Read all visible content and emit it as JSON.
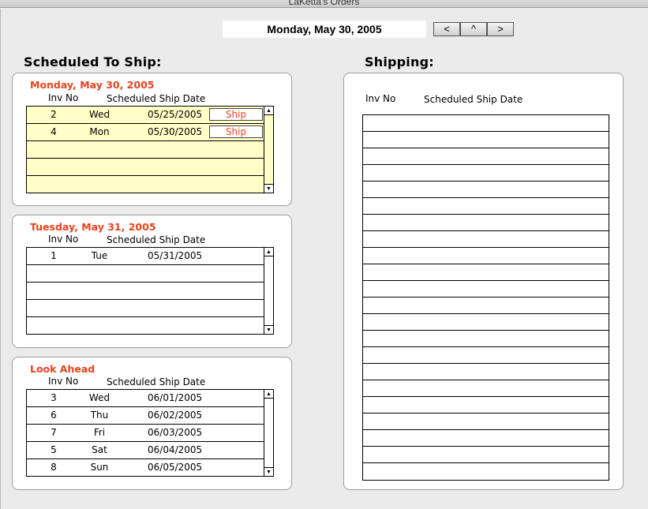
{
  "window": {
    "title": "LaKetta's Orders"
  },
  "header": {
    "date": "Monday, May 30, 2005",
    "nav_prev": "<",
    "nav_up": "^",
    "nav_next": ">"
  },
  "scheduled": {
    "heading": "Scheduled To Ship:",
    "columns": {
      "inv": "Inv No",
      "date": "Scheduled Ship Date"
    },
    "sections": [
      {
        "title": "Monday, May 30, 2005",
        "highlight": "#ffffc8",
        "rows": [
          {
            "inv": "2",
            "day": "Wed",
            "date": "05/25/2005",
            "action": "Ship"
          },
          {
            "inv": "4",
            "day": "Mon",
            "date": "05/30/2005",
            "action": "Ship"
          }
        ]
      },
      {
        "title": "Tuesday, May 31, 2005",
        "rows": [
          {
            "inv": "1",
            "day": "Tue",
            "date": "05/31/2005"
          }
        ]
      },
      {
        "title": "Look Ahead",
        "rows": [
          {
            "inv": "3",
            "day": "Wed",
            "date": "06/01/2005"
          },
          {
            "inv": "6",
            "day": "Thu",
            "date": "06/02/2005"
          },
          {
            "inv": "7",
            "day": "Fri",
            "date": "06/03/2005"
          },
          {
            "inv": "5",
            "day": "Sat",
            "date": "06/04/2005"
          },
          {
            "inv": "8",
            "day": "Sun",
            "date": "06/05/2005"
          }
        ]
      }
    ]
  },
  "shipping": {
    "heading": "Shipping:",
    "columns": {
      "inv": "Inv No",
      "date": "Scheduled Ship Date"
    }
  },
  "colors": {
    "accent": "#e8421e",
    "highlight": "#ffffc8"
  },
  "icons": {
    "scroll_up": "up-arrow-icon",
    "scroll_down": "down-arrow-icon"
  }
}
